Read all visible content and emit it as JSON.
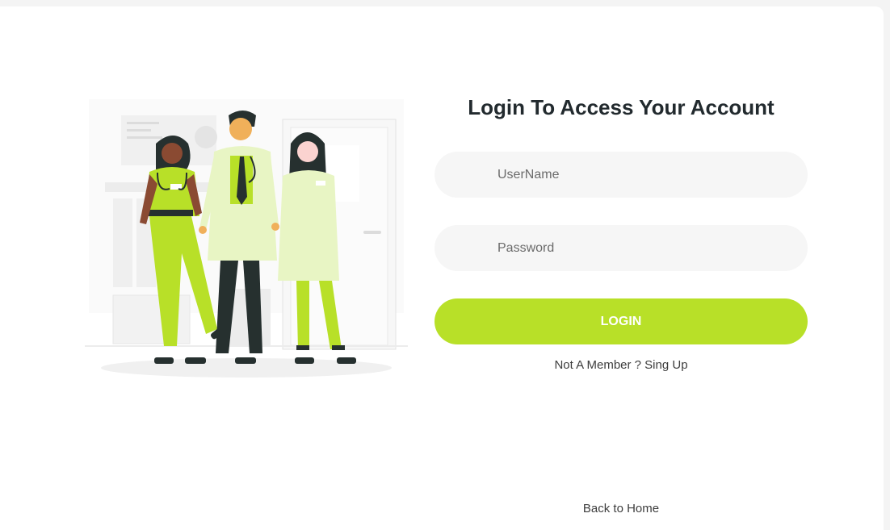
{
  "form": {
    "title": "Login To Access Your Account",
    "username_placeholder": "UserName",
    "password_placeholder": "Password",
    "login_label": "LOGIN",
    "signup_text": "Not A Member ? Sing Up"
  },
  "footer": {
    "home_link": "Back to Home"
  },
  "colors": {
    "accent": "#b8e028",
    "field_bg": "#f6f6f6",
    "title": "#222a2e"
  },
  "illustration": {
    "subject": "three medical staff illustration"
  }
}
